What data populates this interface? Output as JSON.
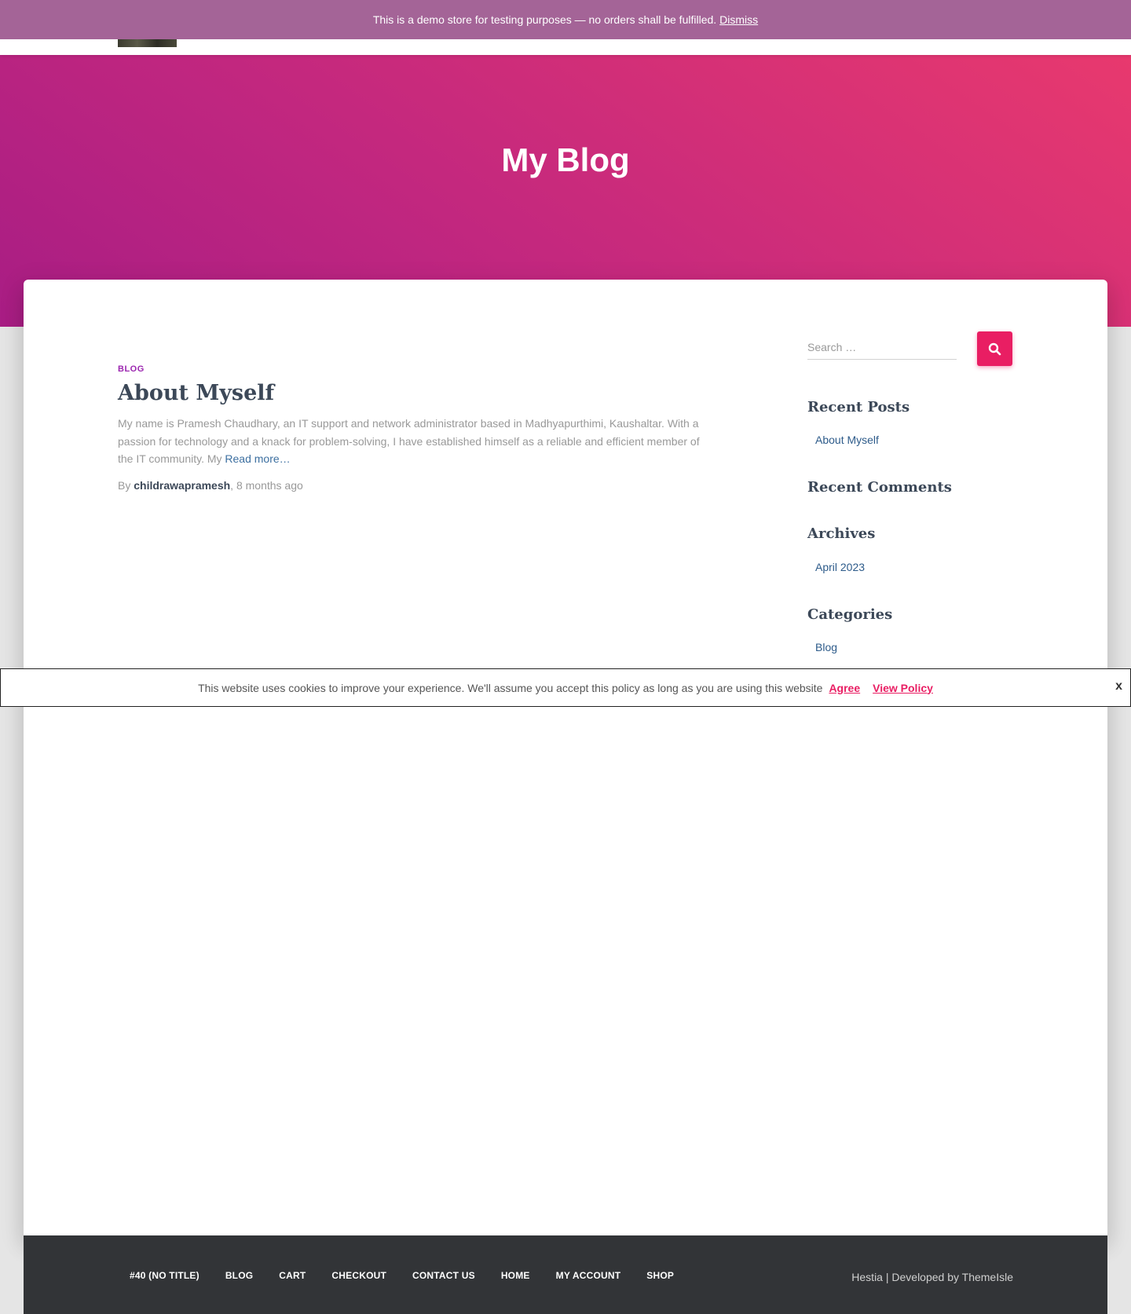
{
  "store_notice": {
    "text": "This is a demo store for testing purposes — no orders shall be fulfilled.",
    "dismiss_label": "Dismiss"
  },
  "hero": {
    "title": "My Blog"
  },
  "post": {
    "category": "BLOG",
    "title": "About Myself",
    "excerpt": "My name is Pramesh Chaudhary, an IT support and network administrator based in Madhyapurthimi, Kaushaltar. With a passion for technology and a knack for problem-solving, I have established himself as a reliable and efficient member of the IT community. My ",
    "read_more": "Read more…",
    "meta_by": "By ",
    "author": "childrawapramesh",
    "separator": ", ",
    "date": "8 months ago"
  },
  "sidebar": {
    "search_placeholder": "Search …",
    "recent_posts_title": "Recent Posts",
    "recent_posts": [
      "About Myself"
    ],
    "recent_comments_title": "Recent Comments",
    "archives_title": "Archives",
    "archives": [
      "April 2023"
    ],
    "categories_title": "Categories",
    "categories": [
      "Blog"
    ]
  },
  "cookie_bar": {
    "text": "This website uses cookies to improve your experience. We'll assume you accept this policy as long as you are using this website",
    "agree_label": "Agree",
    "policy_label": "View Policy",
    "close_label": "x"
  },
  "footer": {
    "menu": [
      "#40 (NO TITLE)",
      "BLOG",
      "CART",
      "CHECKOUT",
      "CONTACT US",
      "HOME",
      "MY ACCOUNT",
      "SHOP"
    ],
    "credit_prefix": "Hestia | Developed by ",
    "credit_link": "ThemeIsle"
  },
  "colors": {
    "accent": "#e91e63",
    "category": "#9c27b0",
    "store_notice_bg": "#a46497",
    "footer_bg": "#323437"
  }
}
